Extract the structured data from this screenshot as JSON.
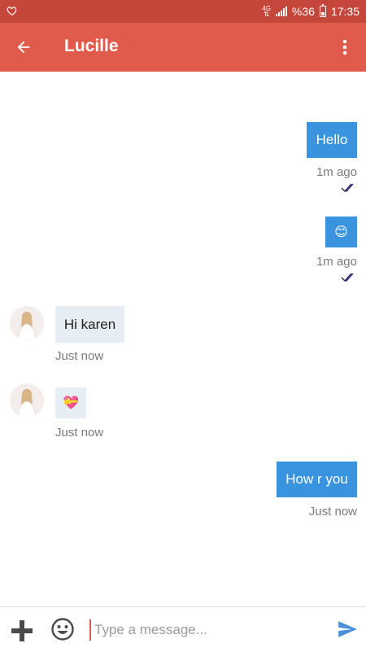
{
  "status_bar": {
    "network": "4G",
    "battery": "%36",
    "time": "17:35"
  },
  "header": {
    "title": "Lucille"
  },
  "messages": [
    {
      "text": "Hello",
      "time": "1m ago",
      "direction": "outgoing",
      "read": true
    },
    {
      "emoji": "😊",
      "time": "1m ago",
      "direction": "outgoing",
      "read": true
    },
    {
      "text": "Hi karen",
      "time": "Just now",
      "direction": "incoming"
    },
    {
      "emoji": "💝",
      "time": "Just now",
      "direction": "incoming"
    },
    {
      "text": "How r you",
      "time": "Just now",
      "direction": "outgoing"
    }
  ],
  "composer": {
    "placeholder": "Type a message..."
  },
  "colors": {
    "status_bar": "#c5463a",
    "app_bar": "#e05b4b",
    "outgoing_bubble": "#3a93de",
    "incoming_bubble": "#e6edf3",
    "send_icon": "#4a90d9"
  },
  "icons": [
    "heart-icon",
    "signal-icon",
    "battery-icon",
    "back-arrow-icon",
    "more-vert-icon",
    "avatar",
    "double-check-icon",
    "plus-icon",
    "emoji-icon",
    "send-icon"
  ]
}
